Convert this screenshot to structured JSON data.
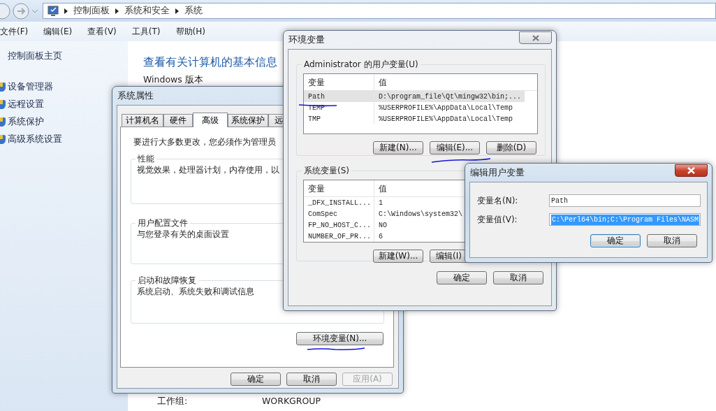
{
  "explorer": {
    "breadcrumbs": [
      "控制面板",
      "系统和安全",
      "系统"
    ],
    "menu": [
      "文件(F)",
      "编辑(E)",
      "查看(V)",
      "工具(T)",
      "帮助(H)"
    ],
    "sidebar": {
      "home": "控制面板主页",
      "items": [
        "设备管理器",
        "远程设置",
        "系统保护",
        "高级系统设置"
      ]
    },
    "heading": "查看有关计算机的基本信息",
    "section": "Windows 版本",
    "workgroup": {
      "label": "工作组:",
      "value": "WORKGROUP"
    }
  },
  "system_properties": {
    "title": "系统属性",
    "tabs": [
      {
        "label": "计算机名",
        "selected": false
      },
      {
        "label": "硬件",
        "selected": false
      },
      {
        "label": "高级",
        "selected": true
      },
      {
        "label": "系统保护",
        "selected": false
      },
      {
        "label": "远",
        "selected": false
      }
    ],
    "notice": "要进行大多数更改，您必须作为管理员",
    "groups": [
      {
        "title": "性能",
        "text": "视觉效果，处理器计划，内存使用，以"
      },
      {
        "title": "用户配置文件",
        "text": "与您登录有关的桌面设置"
      },
      {
        "title": "启动和故障恢复",
        "text": "系统启动、系统失败和调试信息"
      }
    ],
    "env_button": "环境变量(N)...",
    "buttons": [
      {
        "label": "确定",
        "disabled": false
      },
      {
        "label": "取消",
        "disabled": false
      },
      {
        "label": "应用(A)",
        "disabled": true
      }
    ]
  },
  "environment_variables": {
    "title": "环境变量",
    "user_group": {
      "title": "Administrator 的用户变量(U)",
      "columns": [
        "变量",
        "值"
      ],
      "rows": [
        {
          "name": "Path",
          "value": "D:\\program_file\\Qt\\mingw32\\bin;...",
          "selected": true
        },
        {
          "name": "TEMP",
          "value": "%USERPROFILE%\\AppData\\Local\\Temp",
          "selected": false
        },
        {
          "name": "TMP",
          "value": "%USERPROFILE%\\AppData\\Local\\Temp",
          "selected": false
        }
      ],
      "buttons": [
        "新建(N)...",
        "编辑(E)...",
        "删除(D)"
      ]
    },
    "system_group": {
      "title": "系统变量(S)",
      "columns": [
        "变量",
        "值"
      ],
      "rows": [
        {
          "name": "_DFX_INSTALL...",
          "value": "1",
          "selected": false
        },
        {
          "name": "ComSpec",
          "value": "C:\\Windows\\system32\\",
          "selected": false
        },
        {
          "name": "FP_NO_HOST_C...",
          "value": "NO",
          "selected": false
        },
        {
          "name": "NUMBER_OF_PR...",
          "value": "6",
          "selected": false
        }
      ],
      "buttons": [
        "新建(W)...",
        "编辑(I)"
      ]
    },
    "buttons": [
      "确定",
      "取消"
    ]
  },
  "edit_dialog": {
    "title": "编辑用户变量",
    "fields": [
      {
        "label": "变量名(N):",
        "value": "Path",
        "highlighted": false
      },
      {
        "label": "变量值(V):",
        "value": "C:\\Perl64\\bin;C:\\Program Files\\NASM",
        "highlighted": true
      }
    ],
    "buttons": [
      {
        "label": "确定",
        "default": true
      },
      {
        "label": "取消",
        "default": false
      }
    ]
  }
}
